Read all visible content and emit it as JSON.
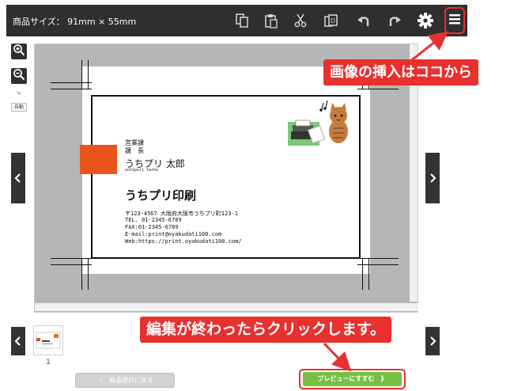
{
  "toolbar": {
    "size_label": "商品サイズ： 91mm × 55mm",
    "icons": [
      "copy-icon",
      "paste-icon",
      "cut-icon",
      "duplicate-icon",
      "undo-icon",
      "redo-icon",
      "gear-icon",
      "menu-icon"
    ]
  },
  "zoom": {
    "percent": "%",
    "auto_label": "自動"
  },
  "card": {
    "department": "営業課",
    "title": "課　長",
    "name": "うちプリ 太郎",
    "name_roman": "uchipuri tarou",
    "company": "うちプリ印刷",
    "address": "〒123-4567 大阪府大阪市うちプリ町123-1",
    "tel": "TEL. 01-2345-6789",
    "fax": "FAX:01-2345-6789",
    "email": "E-mail:print@oyakudati100.com",
    "web": "Web:https://print.oyakudati100.com/"
  },
  "thumbnail": {
    "page_number": "1"
  },
  "buttons": {
    "back_label": "《　商品選択に戻る",
    "preview_label": "プレビューにすすむ　》"
  },
  "annotations": {
    "insert_image": "画像の挿入はココから",
    "click_when_done": "編集が終わったらクリックします。"
  },
  "colors": {
    "toolbar_bg": "#2f2f2f",
    "accent_orange": "#e8541c",
    "annotation_red": "#e8302f",
    "preview_green": "#77c043"
  }
}
